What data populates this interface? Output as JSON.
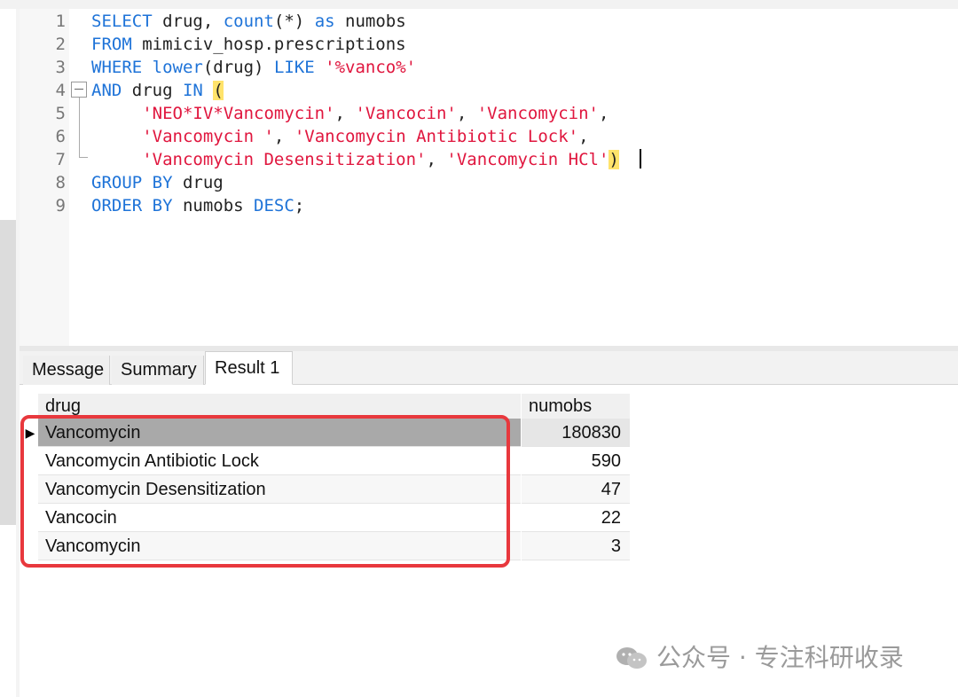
{
  "editor": {
    "line_numbers": [
      "1",
      "2",
      "3",
      "4",
      "5",
      "6",
      "7",
      "8",
      "9"
    ],
    "lines": [
      [
        {
          "t": "SELECT",
          "c": "kw"
        },
        {
          "t": " drug, ",
          "c": ""
        },
        {
          "t": "count",
          "c": "kw"
        },
        {
          "t": "(*) ",
          "c": ""
        },
        {
          "t": "as",
          "c": "kw"
        },
        {
          "t": " numobs",
          "c": ""
        }
      ],
      [
        {
          "t": "FROM",
          "c": "kw"
        },
        {
          "t": " mimiciv_hosp.prescriptions",
          "c": ""
        }
      ],
      [
        {
          "t": "WHERE",
          "c": "kw"
        },
        {
          "t": " ",
          "c": ""
        },
        {
          "t": "lower",
          "c": "kw"
        },
        {
          "t": "(drug) ",
          "c": ""
        },
        {
          "t": "LIKE",
          "c": "kw"
        },
        {
          "t": " ",
          "c": ""
        },
        {
          "t": "'%vanco%'",
          "c": "str"
        }
      ],
      [
        {
          "t": "AND",
          "c": "kw"
        },
        {
          "t": " drug ",
          "c": ""
        },
        {
          "t": "IN",
          "c": "kw"
        },
        {
          "t": " ",
          "c": ""
        },
        {
          "t": "(",
          "c": "paren-hl"
        }
      ],
      [
        {
          "t": "     ",
          "c": ""
        },
        {
          "t": "'NEO*IV*Vancomycin'",
          "c": "str"
        },
        {
          "t": ", ",
          "c": ""
        },
        {
          "t": "'Vancocin'",
          "c": "str"
        },
        {
          "t": ", ",
          "c": ""
        },
        {
          "t": "'Vancomycin'",
          "c": "str"
        },
        {
          "t": ",",
          "c": ""
        }
      ],
      [
        {
          "t": "     ",
          "c": ""
        },
        {
          "t": "'Vancomycin '",
          "c": "str"
        },
        {
          "t": ", ",
          "c": ""
        },
        {
          "t": "'Vancomycin Antibiotic Lock'",
          "c": "str"
        },
        {
          "t": ",",
          "c": ""
        }
      ],
      [
        {
          "t": "     ",
          "c": ""
        },
        {
          "t": "'Vancomycin Desensitization'",
          "c": "str"
        },
        {
          "t": ", ",
          "c": ""
        },
        {
          "t": "'Vancomycin HCl'",
          "c": "str"
        },
        {
          "t": ")",
          "c": "paren-hl"
        }
      ],
      [
        {
          "t": "GROUP BY",
          "c": "kw"
        },
        {
          "t": " drug",
          "c": ""
        }
      ],
      [
        {
          "t": "ORDER BY",
          "c": "kw"
        },
        {
          "t": " numobs ",
          "c": ""
        },
        {
          "t": "DESC",
          "c": "kw"
        },
        {
          "t": ";",
          "c": ""
        }
      ]
    ]
  },
  "tabs": {
    "message": "Message",
    "summary": "Summary",
    "result1": "Result 1",
    "active": "Result 1"
  },
  "table": {
    "columns": [
      "drug",
      "numobs"
    ],
    "rows": [
      {
        "drug": "Vancomycin",
        "numobs": "180830"
      },
      {
        "drug": "Vancomycin Antibiotic Lock",
        "numobs": "590"
      },
      {
        "drug": "Vancomycin Desensitization",
        "numobs": "47"
      },
      {
        "drug": "Vancocin",
        "numobs": "22"
      },
      {
        "drug": "Vancomycin",
        "numobs": "3"
      }
    ],
    "selected_row_indicator": "▶"
  },
  "watermark": "公众号 · 专注科研收录",
  "colors": {
    "keyword": "#1e73d8",
    "string": "#e0163e",
    "highlight_box": "#e8383d"
  }
}
